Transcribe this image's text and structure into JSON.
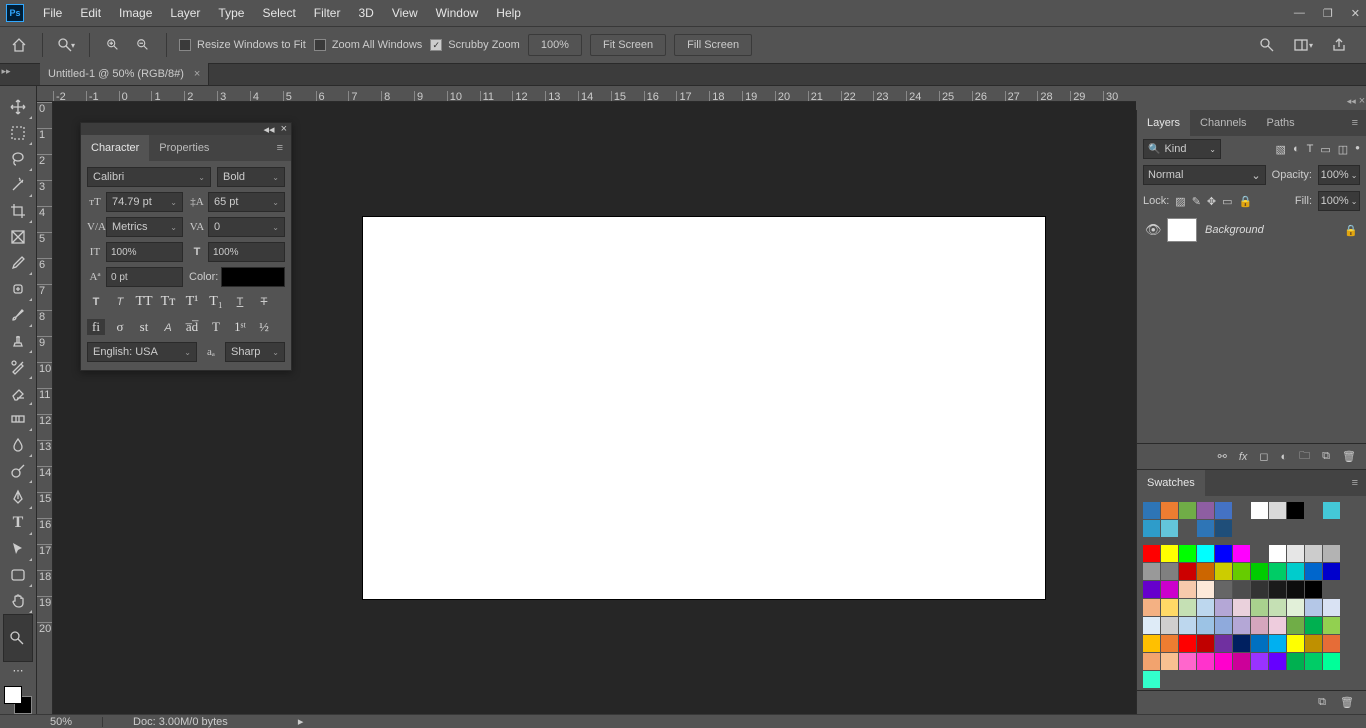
{
  "menu": [
    "File",
    "Edit",
    "Image",
    "Layer",
    "Type",
    "Select",
    "Filter",
    "3D",
    "View",
    "Window",
    "Help"
  ],
  "options": {
    "resize_windows": "Resize Windows to Fit",
    "zoom_all": "Zoom All Windows",
    "scrubby": "Scrubby Zoom",
    "zoom_pct": "100%",
    "fit": "Fit Screen",
    "fill": "Fill Screen"
  },
  "doc_tab": "Untitled-1 @ 50% (RGB/8#)",
  "ruler_h": [
    "-2",
    "-1",
    "0",
    "1",
    "2",
    "3",
    "4",
    "5",
    "6",
    "7",
    "8",
    "9",
    "10",
    "11",
    "12",
    "13",
    "14",
    "15",
    "16",
    "17",
    "18",
    "19",
    "20",
    "21",
    "22",
    "23",
    "24",
    "25",
    "26",
    "27",
    "28",
    "29",
    "30"
  ],
  "ruler_v": [
    "0",
    "1",
    "2",
    "3",
    "4",
    "5",
    "6",
    "7",
    "8",
    "9",
    "10",
    "11",
    "12",
    "13",
    "14",
    "15",
    "16",
    "17",
    "18",
    "19",
    "20"
  ],
  "char": {
    "tab_character": "Character",
    "tab_properties": "Properties",
    "font": "Calibri",
    "style": "Bold",
    "size": "74.79 pt",
    "leading": "65 pt",
    "kerning": "Metrics",
    "tracking": "0",
    "vscale": "100%",
    "hscale": "100%",
    "baseline": "0 pt",
    "color_label": "Color:",
    "lang": "English: USA",
    "aa": "Sharp"
  },
  "layers": {
    "tab_layers": "Layers",
    "tab_channels": "Channels",
    "tab_paths": "Paths",
    "kind": "Kind",
    "blend": "Normal",
    "opacity_label": "Opacity:",
    "opacity": "100%",
    "lock_label": "Lock:",
    "fill_label": "Fill:",
    "fill": "100%",
    "bg_name": "Background"
  },
  "swatches": {
    "title": "Swatches",
    "row0": [
      "#2e75b6",
      "#ed7d31",
      "#70ad47",
      "#8e5ea2",
      "#4472c4",
      "",
      "#ffffff",
      "#d9d9d9",
      "#000000",
      "",
      "#44c8d7",
      "#2e9cca",
      "#63c5da",
      "",
      "#2e75b6",
      "#1f4e79"
    ],
    "grid": [
      "#ff0000",
      "#ffff00",
      "#00ff00",
      "#00ffff",
      "#0000ff",
      "#ff00ff",
      "",
      "#ffffff",
      "#e6e6e6",
      "#cccccc",
      "#b3b3b3",
      "#999999",
      "#808080",
      "#cc0000",
      "#cc6600",
      "#cccc00",
      "#66cc00",
      "#00cc00",
      "#00cc66",
      "#00cccc",
      "#0066cc",
      "#0000cc",
      "#6600cc",
      "#cc00cc",
      "#f7caac",
      "#fde9d9",
      "#666666",
      "#4d4d4d",
      "#333333",
      "#1a1a1a",
      "#0d0d0d",
      "#000000",
      "",
      "#f4b183",
      "#ffd966",
      "#c5e0b4",
      "#bdd7ee",
      "#b4a7d6",
      "#ead1dc",
      "#a9d18e",
      "#c5e0b4",
      "#e2f0d9",
      "#b4c7e7",
      "#d9e2f3",
      "#deebf7",
      "#d0cece",
      "#bdd7ee",
      "#9cc3e5",
      "#8faadc",
      "#b4a7d6",
      "#d5a6bd",
      "#eeccdd",
      "#70ad47",
      "#00b050",
      "#92d050",
      "#ffc000",
      "#ed7d31",
      "#ff0000",
      "#c00000",
      "#7030a0",
      "#002060",
      "#0070c0",
      "#00b0f0",
      "#ffff00",
      "#bf9000",
      "#e66c37",
      "#f2a36e",
      "#f8c191",
      "#ff66cc",
      "#ff33cc",
      "#ff00cc",
      "#cc0099",
      "#9933ff",
      "#6600ff",
      "#00b050",
      "#00cc66",
      "#00ff99",
      "#33ffcc"
    ]
  },
  "status": {
    "zoom": "50%",
    "doc": "Doc: 3.00M/0 bytes"
  }
}
